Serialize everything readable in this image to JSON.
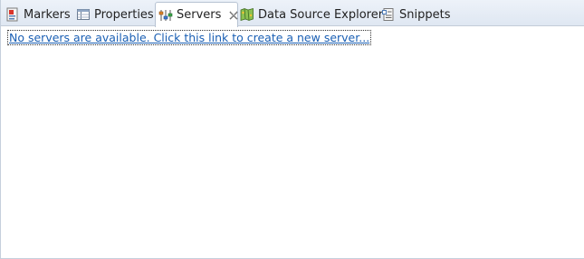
{
  "tabs": [
    {
      "label": "Markers",
      "icon": "markers-icon"
    },
    {
      "label": "Properties",
      "icon": "properties-icon"
    },
    {
      "label": "Servers",
      "icon": "servers-icon",
      "active": true,
      "closable": true
    },
    {
      "label": "Data Source Explorer",
      "icon": "data-source-explorer-icon"
    },
    {
      "label": "Snippets",
      "icon": "snippets-icon"
    }
  ],
  "servers_view": {
    "empty_link_text": "No servers are available. Click this link to create a new server..."
  },
  "colors": {
    "link": "#1a5fb4",
    "tabbar_background": "#dfe7f2",
    "active_tab_background": "#ffffff"
  }
}
